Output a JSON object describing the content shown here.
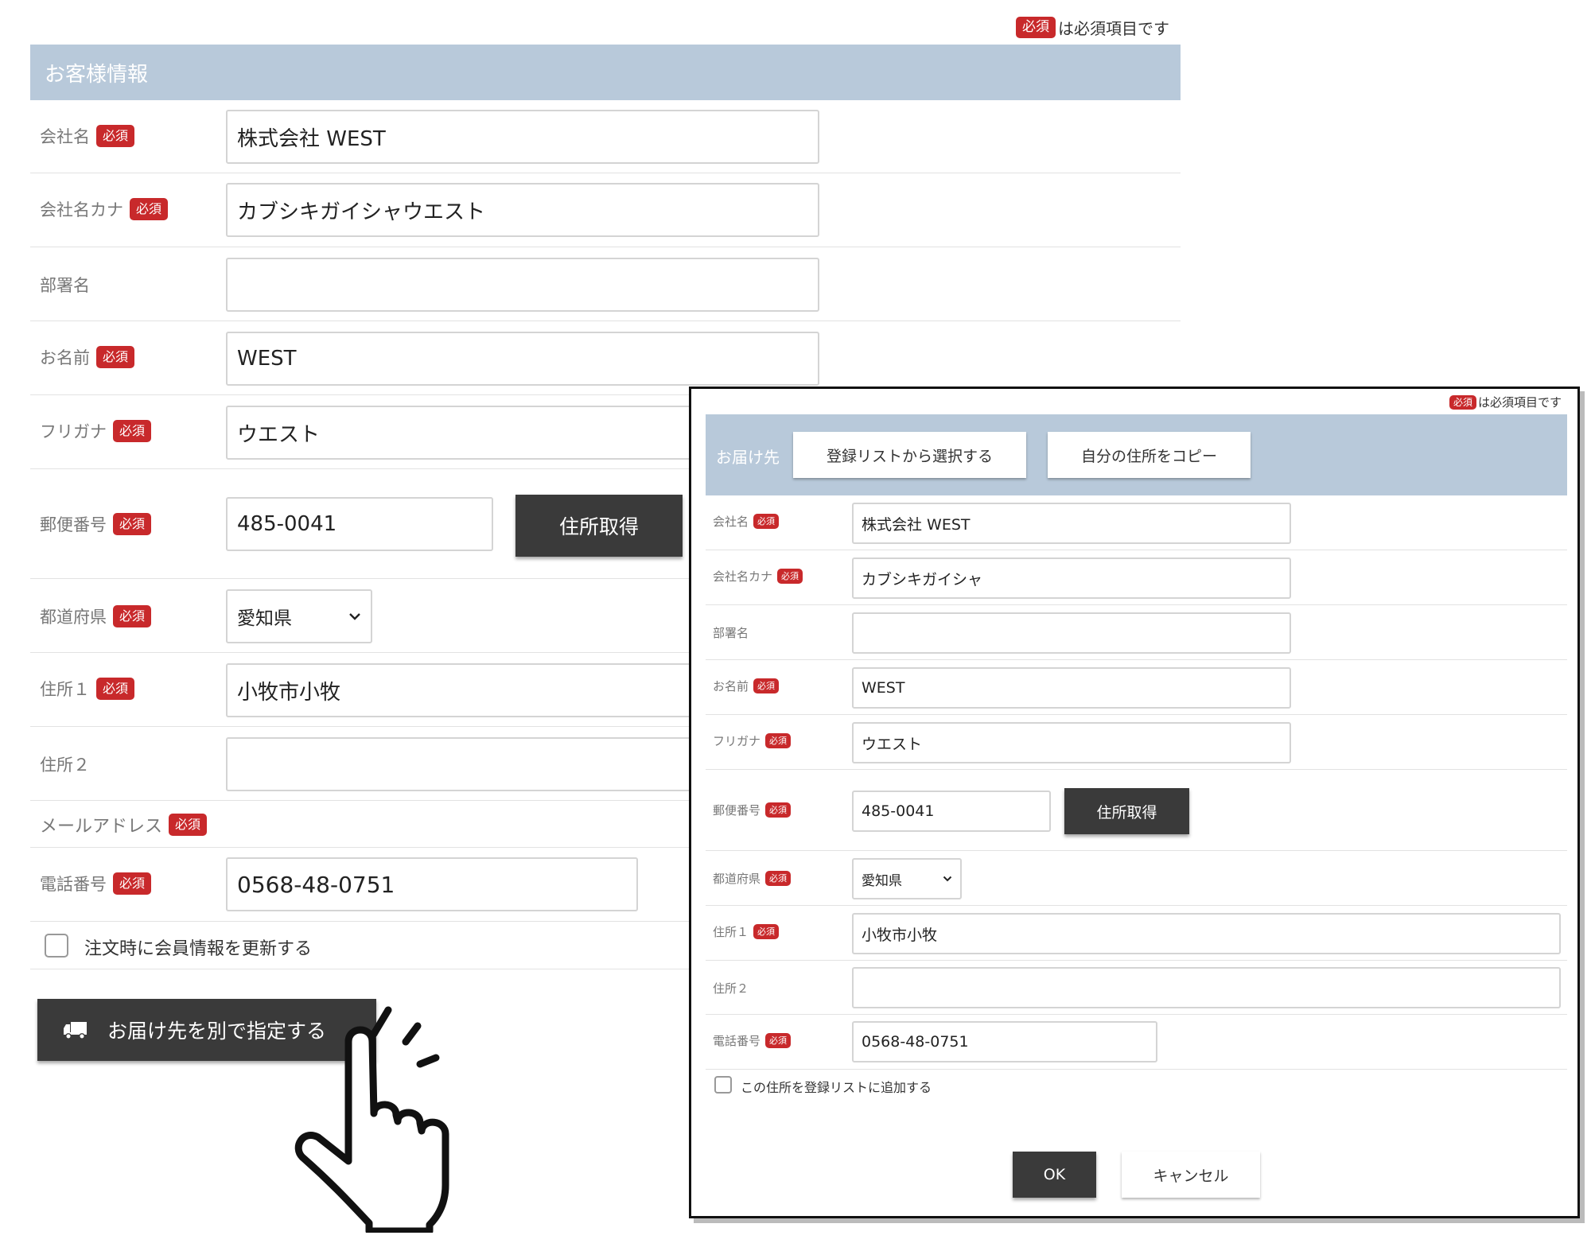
{
  "required_badge": "必須",
  "required_note": "は必須項目です",
  "main_form": {
    "section_title": "お客様情報",
    "fields": {
      "company_label": "会社名",
      "company_value": "株式会社 WEST",
      "company_kana_label": "会社名カナ",
      "company_kana_value": "カブシキガイシャウエスト",
      "department_label": "部署名",
      "department_value": "",
      "name_label": "お名前",
      "name_value": "WEST",
      "furigana_label": "フリガナ",
      "furigana_value": "ウエスト",
      "postal_label": "郵便番号",
      "postal_value": "485-0041",
      "prefecture_label": "都道府県",
      "prefecture_value": "愛知県",
      "address1_label": "住所１",
      "address1_value": "小牧市小牧",
      "address2_label": "住所２",
      "address2_value": "",
      "email_label": "メールアドレス",
      "phone_label": "電話番号",
      "phone_value": "0568-48-0751"
    },
    "get_address_button": "住所取得",
    "update_member_checkbox": "注文時に会員情報を更新する",
    "specify_delivery_button": "お届け先を別で指定する"
  },
  "dialog": {
    "section_title": "お届け先",
    "select_from_list_button": "登録リストから選択する",
    "copy_my_address_button": "自分の住所をコピー",
    "fields": {
      "company_label": "会社名",
      "company_value": "株式会社 WEST",
      "company_kana_label": "会社名カナ",
      "company_kana_value": "カブシキガイシャ",
      "department_label": "部署名",
      "department_value": "",
      "name_label": "お名前",
      "name_value": "WEST",
      "furigana_label": "フリガナ",
      "furigana_value": "ウエスト",
      "postal_label": "郵便番号",
      "postal_value": "485-0041",
      "prefecture_label": "都道府県",
      "prefecture_value": "愛知県",
      "address1_label": "住所１",
      "address1_value": "小牧市小牧",
      "address2_label": "住所２",
      "address2_value": "",
      "phone_label": "電話番号",
      "phone_value": "0568-48-0751"
    },
    "get_address_button": "住所取得",
    "add_to_list_checkbox": "この住所を登録リストに追加する",
    "ok_button": "OK",
    "cancel_button": "キャンセル"
  },
  "colors": {
    "header_bg": "#b8c9da",
    "required_badge": "#c8292b",
    "dark_button": "#3a3a3a"
  },
  "icons": {
    "truck": "truck-icon",
    "pointer": "pointing-hand-icon",
    "dropdown": "chevron-down-icon"
  }
}
